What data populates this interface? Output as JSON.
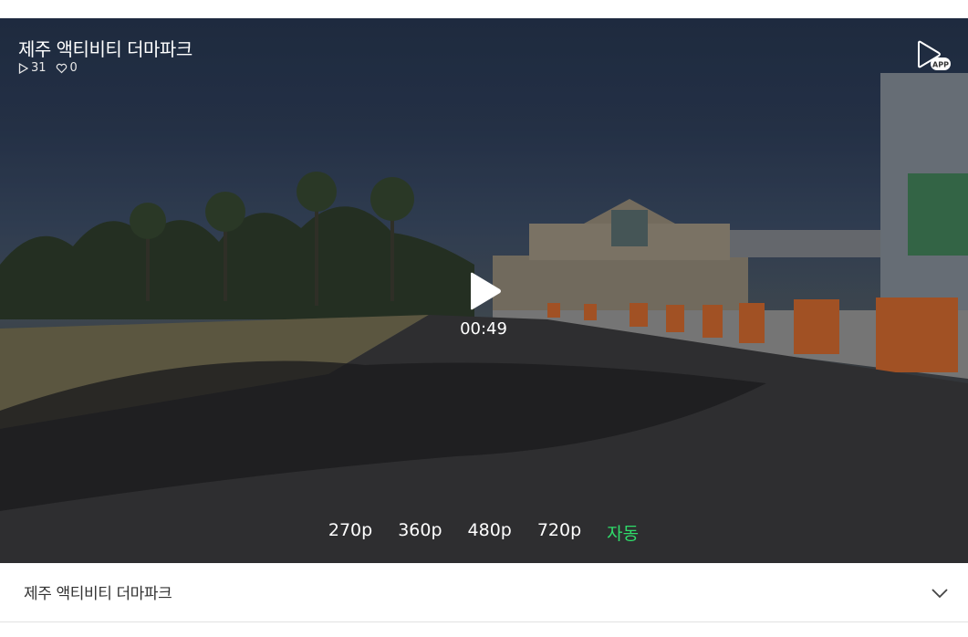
{
  "video": {
    "title": "제주 액티비티 더마파크",
    "play_count": "31",
    "like_count": "0",
    "duration": "00:49",
    "app_badge": "APP"
  },
  "icons": {
    "play_count": "play-outline-icon",
    "like_count": "heart-outline-icon",
    "app": "app-launch-icon",
    "play": "play-icon",
    "expand": "chevron-down-icon"
  },
  "quality": {
    "options": [
      "270p",
      "360p",
      "480p",
      "720p",
      "자동"
    ],
    "selected": "자동"
  },
  "info_bar": {
    "title": "제주 액티비티 더마파크"
  },
  "colors": {
    "selected_quality": "#2fdc6a",
    "overlay_text": "#ffffff",
    "info_title": "#333333"
  }
}
